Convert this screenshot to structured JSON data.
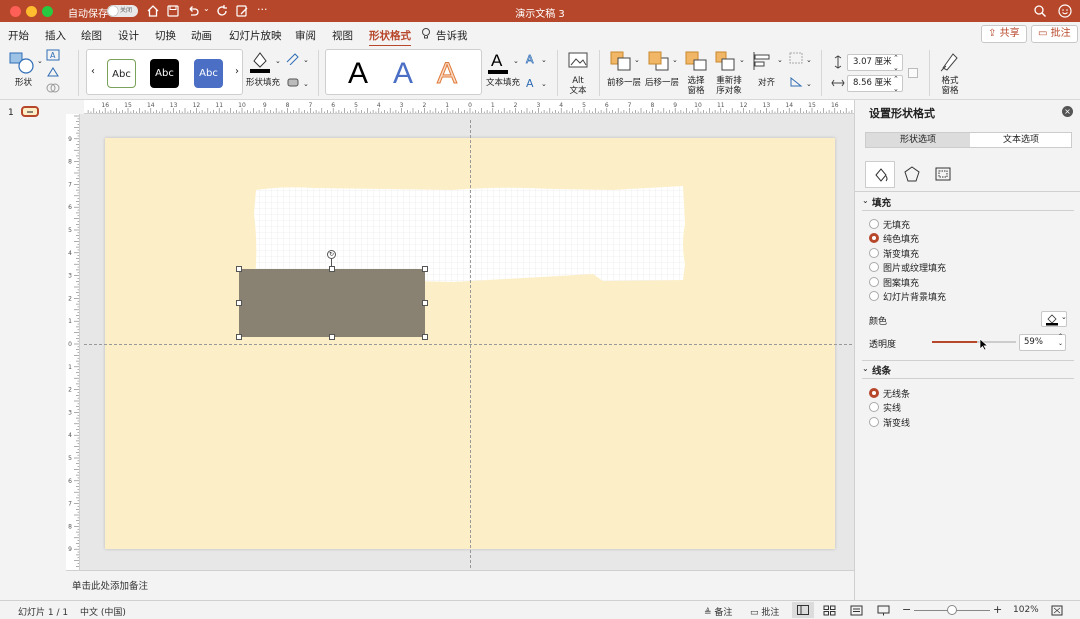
{
  "titlebar": {
    "autosave_label": "自动保存",
    "autosave_state": "关闭",
    "doc_title": "演示文稿 3"
  },
  "menu": {
    "items": [
      "开始",
      "插入",
      "绘图",
      "设计",
      "切换",
      "动画",
      "幻灯片放映",
      "审阅",
      "视图",
      "形状格式"
    ],
    "tell_me": "告诉我",
    "share": "共享",
    "comments": "批注"
  },
  "ribbon": {
    "shape_label": "形状",
    "styles": [
      "Abc",
      "Abc",
      "Abc"
    ],
    "shape_fill_label": "形状填充",
    "wordart": [
      "A",
      "A",
      "A"
    ],
    "text_fill_label": "文本填充",
    "alt_text_label": "Alt\n文本",
    "bring_forward": "前移一层",
    "send_backward": "后移一层",
    "selection_pane": "选择\n窗格",
    "reorder": "重新排\n序对象",
    "align": "对齐",
    "height": "3.07 厘米",
    "width": "8.56 厘米",
    "format_pane": "格式\n窗格"
  },
  "thumbnails": {
    "slide_number": "1"
  },
  "ruler": {
    "h_ticks": [
      "16",
      "15",
      "14",
      "13",
      "12",
      "11",
      "10",
      "9",
      "8",
      "7",
      "6",
      "5",
      "4",
      "3",
      "2",
      "1",
      "0",
      "1",
      "2",
      "3",
      "4",
      "5",
      "6",
      "7",
      "8",
      "9",
      "10",
      "11",
      "12",
      "13",
      "14",
      "15",
      "16"
    ],
    "v_ticks": [
      "9",
      "8",
      "7",
      "6",
      "5",
      "4",
      "3",
      "2",
      "1",
      "0",
      "1",
      "2",
      "3",
      "4",
      "5",
      "6",
      "7",
      "8",
      "9"
    ]
  },
  "notes": {
    "placeholder": "单击此处添加备注"
  },
  "pane": {
    "title": "设置形状格式",
    "tabs": [
      "形状选项",
      "文本选项"
    ],
    "fill_section": "填充",
    "fill_options": [
      "无填充",
      "纯色填充",
      "渐变填充",
      "图片或纹理填充",
      "图案填充",
      "幻灯片背景填充"
    ],
    "fill_selected": 1,
    "color_label": "颜色",
    "transparency_label": "透明度",
    "transparency_value": "59%",
    "transparency_level": 0.59,
    "line_section": "线条",
    "line_options": [
      "无线条",
      "实线",
      "渐变线"
    ],
    "line_selected": 0
  },
  "status": {
    "slide_info": "幻灯片 1 / 1",
    "language": "中文 (中国)",
    "notes": "备注",
    "comments": "批注",
    "zoom": "102%"
  },
  "colors": {
    "accent": "#b7472a",
    "slide_bg": "#fcefc8",
    "shape_fill": "#898273"
  }
}
